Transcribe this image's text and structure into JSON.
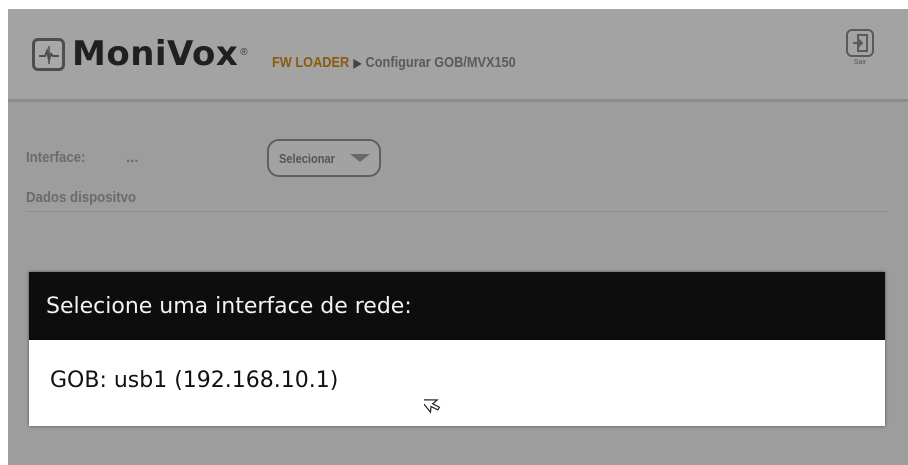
{
  "header": {
    "logo_text": "MoniVox",
    "logo_trademark": "®",
    "breadcrumb_root": "FW LOADER",
    "breadcrumb_separator": "▶",
    "breadcrumb_current": "Configurar GOB/MVX150",
    "exit_label": "Sair"
  },
  "form": {
    "interface_label": "Interface:",
    "interface_value": "...",
    "select_button_label": "Selecionar",
    "device_data_label": "Dados dispositvo"
  },
  "dialog": {
    "title": "Selecione uma interface de rede:",
    "options": [
      {
        "label": "GOB: usb1 (192.168.10.1)"
      }
    ]
  },
  "colors": {
    "overlay_background": "#9d9d9d",
    "dialog_title_background": "#0d0d0d",
    "dialog_body_background": "#ffffff",
    "breadcrumb_root": "#8a5a0f"
  },
  "icons": {
    "logo": "monivox-logo-icon",
    "exit": "exit-icon",
    "select_caret": "caret-down-icon",
    "cursor": "mouse-cursor-icon"
  }
}
